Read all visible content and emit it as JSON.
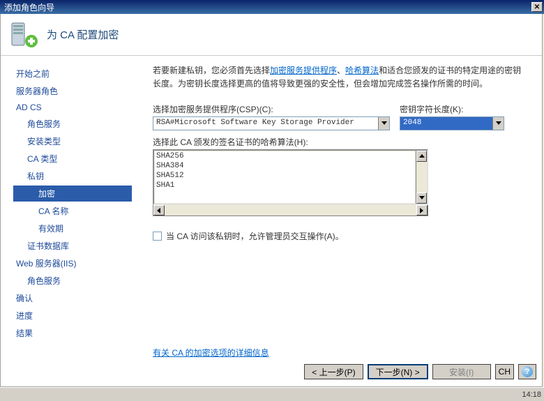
{
  "titlebar": {
    "title": "添加角色向导"
  },
  "header": {
    "title": "为 CA 配置加密"
  },
  "sidebar": {
    "items": [
      {
        "label": "开始之前",
        "indent": 0
      },
      {
        "label": "服务器角色",
        "indent": 0
      },
      {
        "label": "AD CS",
        "indent": 0
      },
      {
        "label": "角色服务",
        "indent": 1
      },
      {
        "label": "安装类型",
        "indent": 1
      },
      {
        "label": "CA 类型",
        "indent": 1
      },
      {
        "label": "私钥",
        "indent": 1
      },
      {
        "label": "加密",
        "selected": true,
        "indent": 2
      },
      {
        "label": "CA 名称",
        "indent": 2
      },
      {
        "label": "有效期",
        "indent": 2
      },
      {
        "label": "证书数据库",
        "indent": 1
      },
      {
        "label": "Web 服务器(IIS)",
        "indent": 0
      },
      {
        "label": "角色服务",
        "indent": 1
      },
      {
        "label": "确认",
        "indent": 0
      },
      {
        "label": "进度",
        "indent": 0
      },
      {
        "label": "结果",
        "indent": 0
      }
    ]
  },
  "content": {
    "intro_before": "若要新建私钥，您必须首先选择",
    "intro_link1": "加密服务提供程序",
    "intro_sep": "、",
    "intro_link2": "哈希算法",
    "intro_after": "和适合您颁发的证书的特定用途的密钥长度。为密钥长度选择更高的值将导致更强的安全性，但会增加完成签名操作所需的时间。",
    "csp_label": "选择加密服务提供程序(CSP)(C):",
    "csp_value": "RSA#Microsoft Software Key Storage Provider",
    "keylen_label": "密钥字符长度(K):",
    "keylen_value": "2048",
    "hash_label": "选择此 CA 颁发的签名证书的哈希算法(H):",
    "hash_options": [
      "SHA256",
      "SHA384",
      "SHA512",
      "SHA1"
    ],
    "checkbox_label": "当 CA 访问该私钥时，允许管理员交互操作(A)。",
    "details_link": "有关 CA 的加密选项的详细信息"
  },
  "buttons": {
    "prev": "< 上一步(P)",
    "next": "下一步(N) >",
    "install": "安装(I)",
    "cancel": "CH"
  },
  "taskbar": {
    "time": "14:18"
  }
}
